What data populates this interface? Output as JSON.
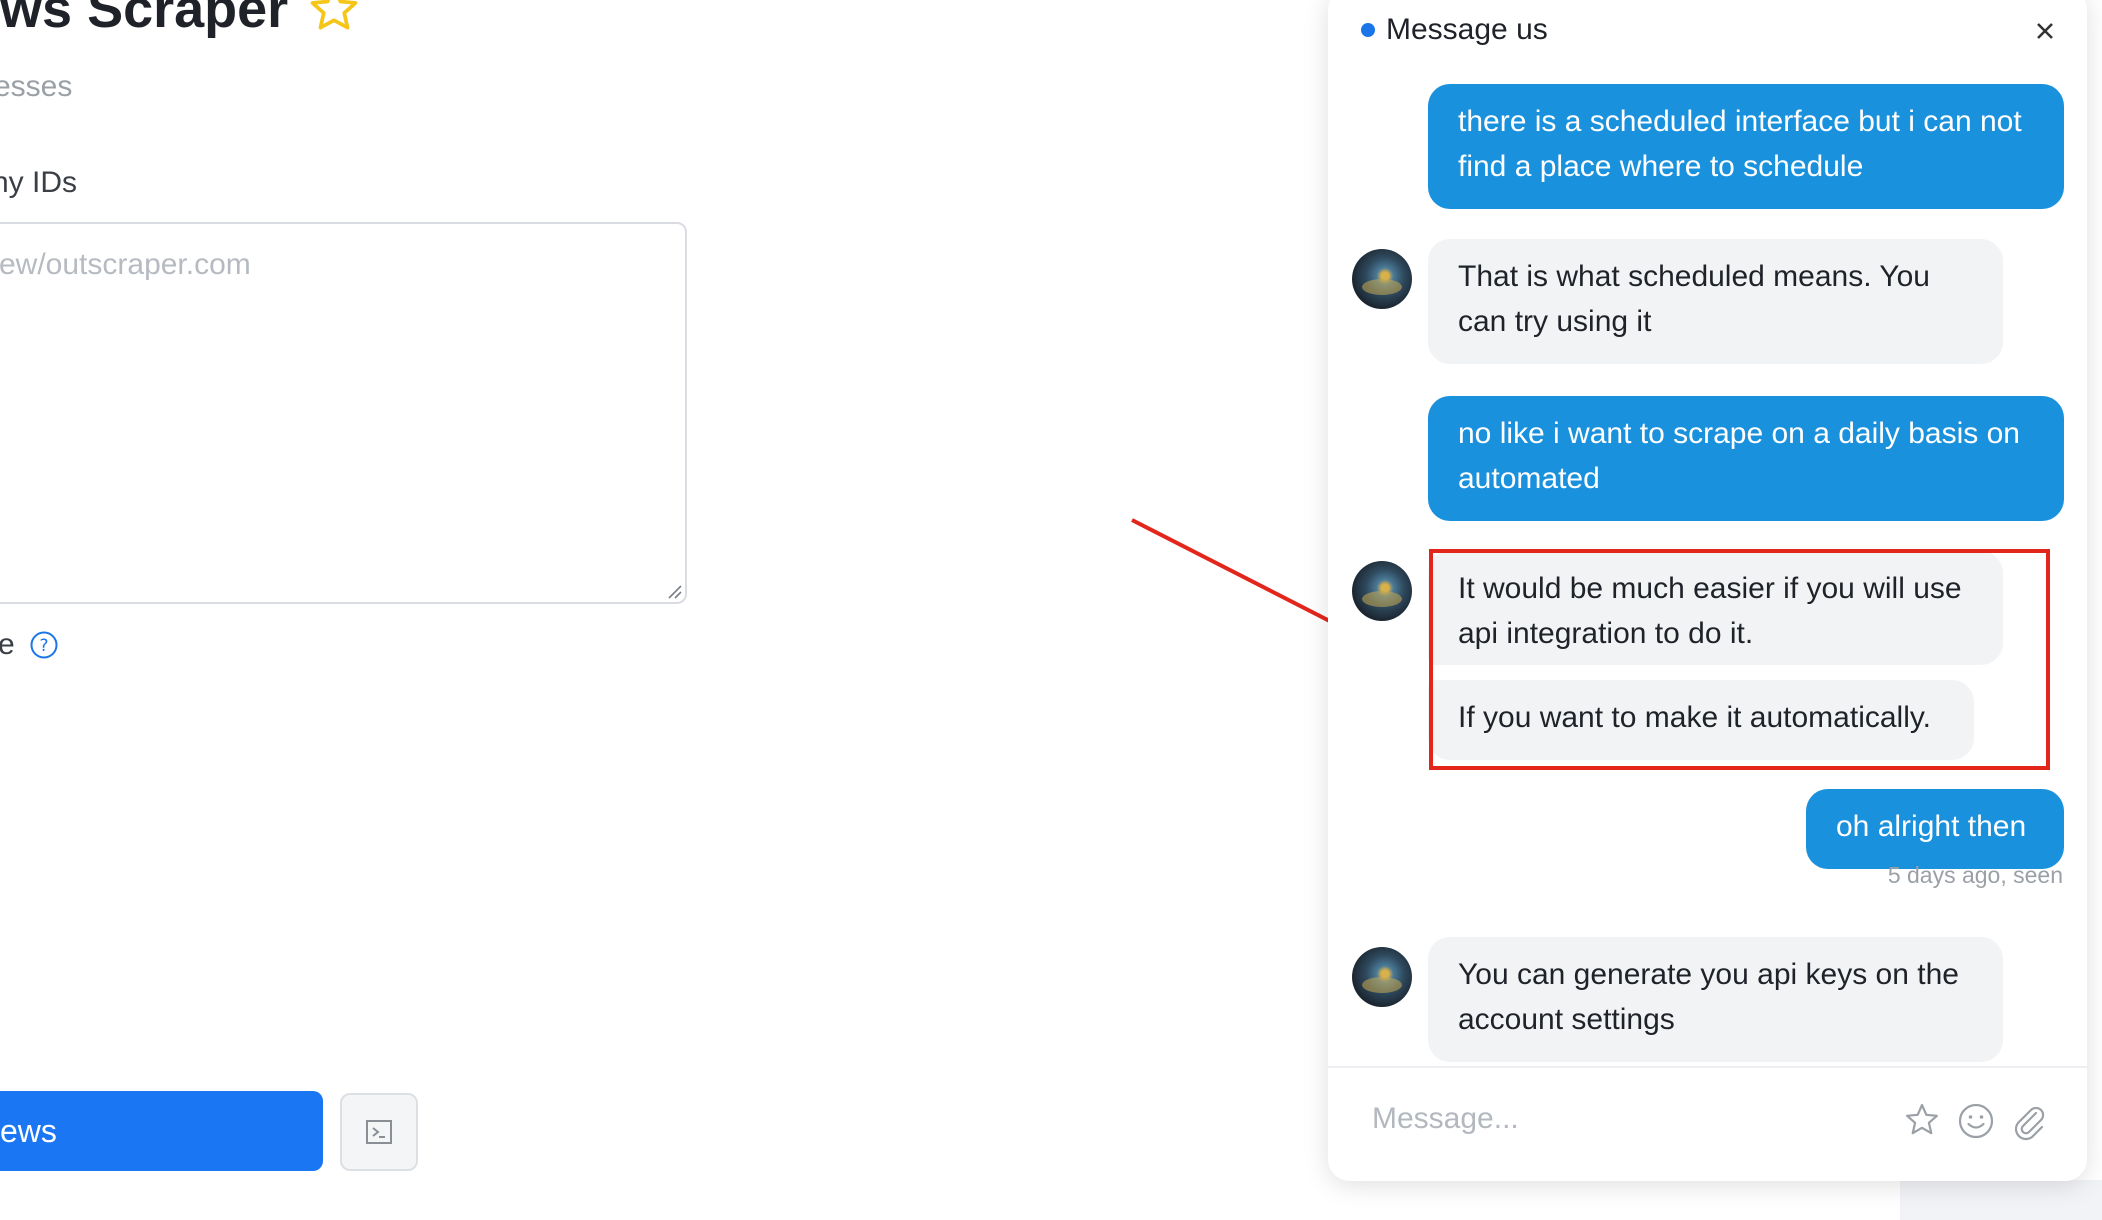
{
  "app": {
    "title": "ews Scraper",
    "subtitle": "esses",
    "ids_label": "ny IDs",
    "ids_placeholder": "ew/outscraper.com",
    "option_label": "e",
    "primary_button_label": "ews"
  },
  "chat": {
    "title": "Message us",
    "composer_placeholder": "Message...",
    "messages": [
      {
        "sender": "user",
        "text": "there is a scheduled interface but i can not find a place where to schedule"
      },
      {
        "sender": "agent",
        "text": "That is what scheduled means. You can try using it"
      },
      {
        "sender": "user",
        "text": "no like i want to scrape on a daily basis on automated"
      },
      {
        "sender": "agent",
        "text": "It would be much easier if you will use api integration to do it."
      },
      {
        "sender": "agent",
        "text": "If you want to make it automatically."
      },
      {
        "sender": "user",
        "text": "oh alright then"
      },
      {
        "sender": "agent",
        "text": "You can generate you api keys on the account settings"
      }
    ],
    "seen_status": "5 days ago, seen"
  },
  "colors": {
    "user_bubble": "#1a91dd",
    "agent_bubble": "#f2f3f5",
    "primary_button": "#1a76f2",
    "annotation": "#e3261c",
    "star": "#f5c518"
  },
  "icons": {
    "title_star": "star-outline-icon",
    "help": "question-circle-icon",
    "console": "terminal-icon",
    "close": "close-icon",
    "composer": [
      "star-sparkle-icon",
      "smiley-icon",
      "paperclip-icon"
    ]
  }
}
